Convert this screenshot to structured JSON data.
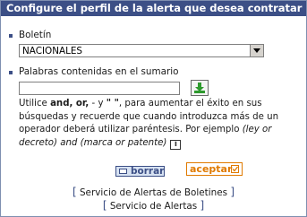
{
  "header": {
    "title": "Configure el perfil de la alerta que desea contratar"
  },
  "boletin": {
    "label": "Boletín",
    "selected": "NACIONALES"
  },
  "palabras": {
    "label": "Palabras contenidas en el sumario",
    "value": "",
    "help_1": "Utilice ",
    "help_and": "and, or,",
    "help_2": " - y ",
    "help_quotes": "\" \"",
    "help_3": ", para aumentar el éxito en sus búsquedas y recuerde que cuando introduzca más de un operador deberá utilizar paréntesis. Por ejemplo ",
    "help_example": "(ley or decreto) and (marca or patente)"
  },
  "buttons": {
    "borrar": "borrar",
    "aceptar": "aceptar"
  },
  "links": {
    "servicio_boletines": "Servicio de Alertas de Boletines",
    "servicio_alertas": "Servicio de Alertas"
  },
  "icons": {
    "add": "add-arrow-icon",
    "info": "info-icon",
    "check": "check-icon"
  },
  "colors": {
    "header_bg": "#3c4f86",
    "accent_orange": "#e07a00",
    "add_green": "#2e9a2e"
  }
}
